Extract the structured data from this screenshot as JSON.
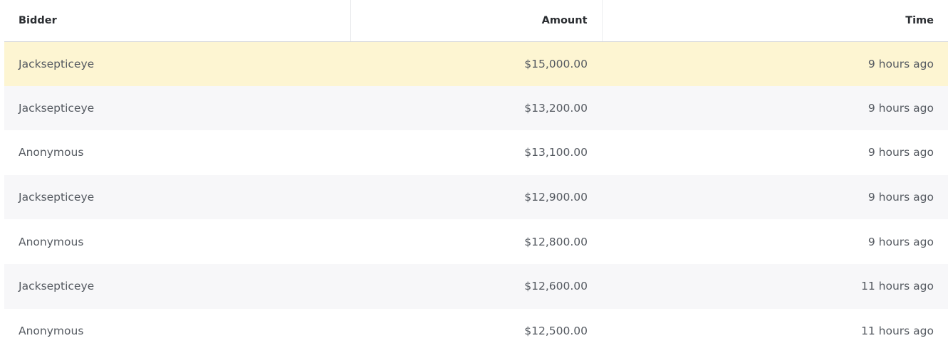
{
  "columns": {
    "bidder": "Bidder",
    "amount": "Amount",
    "time": "Time"
  },
  "colors": {
    "highlight_row": "#fdf5d2",
    "striped_row": "#f7f7f9",
    "header_text": "#2a2d31",
    "body_text": "#555a61"
  },
  "rows": [
    {
      "bidder": "Jacksepticeye",
      "amount": "$15,000.00",
      "time": "9 hours ago",
      "highlighted": true
    },
    {
      "bidder": "Jacksepticeye",
      "amount": "$13,200.00",
      "time": "9 hours ago",
      "highlighted": false
    },
    {
      "bidder": "Anonymous",
      "amount": "$13,100.00",
      "time": "9 hours ago",
      "highlighted": false
    },
    {
      "bidder": "Jacksepticeye",
      "amount": "$12,900.00",
      "time": "9 hours ago",
      "highlighted": false
    },
    {
      "bidder": "Anonymous",
      "amount": "$12,800.00",
      "time": "9 hours ago",
      "highlighted": false
    },
    {
      "bidder": "Jacksepticeye",
      "amount": "$12,600.00",
      "time": "11 hours ago",
      "highlighted": false
    },
    {
      "bidder": "Anonymous",
      "amount": "$12,500.00",
      "time": "11 hours ago",
      "highlighted": false
    }
  ]
}
